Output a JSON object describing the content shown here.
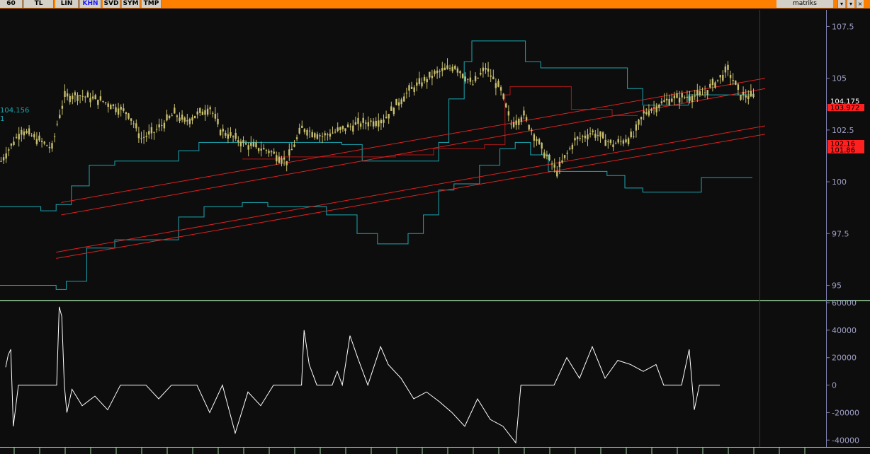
{
  "toolbar": {
    "buttons": [
      "60",
      "TL",
      "LIN",
      "KHN",
      "SVD",
      "SYM",
      "TMP"
    ],
    "active": "KHN",
    "brand": "matriks",
    "window_buttons": [
      "▾",
      "▾",
      "×"
    ]
  },
  "colors": {
    "background": "#0d0d0d",
    "candle": "#c8bf6e",
    "envelope": "#1aa7b0",
    "channel": "#e02020",
    "midline": "#b01818",
    "oscillator": "#ffffff",
    "axis_text": "#a0a0c8",
    "price_badge": "#ff2020"
  },
  "chart_data": [
    {
      "type": "line",
      "panel": "price",
      "subtype": "candlestick-with-channels",
      "ylim": [
        94.3,
        108.3
      ],
      "yticks": [
        "107.5",
        "105",
        "102.5",
        "100",
        "97.5",
        "95"
      ],
      "left_labels": [
        "104.156",
        "1"
      ],
      "price_badges": [
        "104.175",
        "103.972",
        "102.16",
        "101.86"
      ],
      "bar_count": 300,
      "close_path": [
        [
          0,
          101
        ],
        [
          8,
          102.5
        ],
        [
          15,
          102
        ],
        [
          20,
          101.6
        ],
        [
          22,
          102.8
        ],
        [
          25,
          104.1
        ],
        [
          30,
          104.2
        ],
        [
          40,
          103.9
        ],
        [
          50,
          103.3
        ],
        [
          55,
          102.1
        ],
        [
          60,
          102.4
        ],
        [
          68,
          103.3
        ],
        [
          72,
          102.9
        ],
        [
          82,
          103.6
        ],
        [
          86,
          102.5
        ],
        [
          96,
          101.8
        ],
        [
          105,
          101.5
        ],
        [
          112,
          101
        ],
        [
          118,
          102.6
        ],
        [
          126,
          102.2
        ],
        [
          140,
          102.8
        ],
        [
          150,
          103
        ],
        [
          160,
          104.4
        ],
        [
          170,
          105.2
        ],
        [
          178,
          105.6
        ],
        [
          185,
          104.7
        ],
        [
          190,
          105.5
        ],
        [
          196,
          104.4
        ],
        [
          200,
          102.8
        ],
        [
          205,
          103.2
        ],
        [
          212,
          101.6
        ],
        [
          218,
          100.5
        ],
        [
          225,
          102
        ],
        [
          232,
          102.4
        ],
        [
          240,
          101.8
        ],
        [
          248,
          102.2
        ],
        [
          252,
          103.3
        ],
        [
          262,
          104
        ],
        [
          275,
          104.2
        ],
        [
          285,
          105.4
        ],
        [
          290,
          104.2
        ],
        [
          295,
          104.1
        ]
      ],
      "envelope_upper": [
        [
          0,
          98.8
        ],
        [
          16,
          98.6
        ],
        [
          22,
          98.9
        ],
        [
          28,
          99.8
        ],
        [
          35,
          100.8
        ],
        [
          45,
          101
        ],
        [
          62,
          101
        ],
        [
          70,
          101.5
        ],
        [
          78,
          101.9
        ],
        [
          95,
          101.9
        ],
        [
          108,
          101.9
        ],
        [
          120,
          101.9
        ],
        [
          134,
          101.8
        ],
        [
          142,
          101
        ],
        [
          152,
          101
        ],
        [
          165,
          101
        ],
        [
          172,
          101.9
        ],
        [
          176,
          104
        ],
        [
          182,
          105.8
        ],
        [
          185,
          106.8
        ],
        [
          190,
          106.8
        ],
        [
          200,
          106.8
        ],
        [
          206,
          105.8
        ],
        [
          212,
          105.5
        ],
        [
          230,
          105.5
        ],
        [
          240,
          105.5
        ],
        [
          246,
          104.5
        ],
        [
          252,
          103.7
        ],
        [
          262,
          103.7
        ],
        [
          270,
          104.2
        ],
        [
          285,
          104.2
        ],
        [
          295,
          104.2
        ]
      ],
      "envelope_lower": [
        [
          0,
          95
        ],
        [
          18,
          95
        ],
        [
          22,
          94.8
        ],
        [
          26,
          95.2
        ],
        [
          34,
          96.8
        ],
        [
          45,
          97.2
        ],
        [
          60,
          97.2
        ],
        [
          70,
          98.3
        ],
        [
          80,
          98.8
        ],
        [
          95,
          99
        ],
        [
          105,
          98.8
        ],
        [
          115,
          98.8
        ],
        [
          128,
          98.4
        ],
        [
          140,
          97.5
        ],
        [
          148,
          97
        ],
        [
          160,
          97.5
        ],
        [
          166,
          98.4
        ],
        [
          172,
          99.6
        ],
        [
          178,
          99.9
        ],
        [
          188,
          100.8
        ],
        [
          196,
          101.6
        ],
        [
          202,
          101.9
        ],
        [
          208,
          101.3
        ],
        [
          215,
          100.5
        ],
        [
          230,
          100.5
        ],
        [
          238,
          100.3
        ],
        [
          245,
          99.7
        ],
        [
          252,
          99.5
        ],
        [
          265,
          99.5
        ],
        [
          275,
          100.2
        ],
        [
          285,
          100.2
        ],
        [
          295,
          100.2
        ]
      ],
      "midline": [
        [
          95,
          101.1
        ],
        [
          100,
          101.1
        ],
        [
          105,
          101.1
        ],
        [
          110,
          101.2
        ],
        [
          115,
          101.2
        ],
        [
          120,
          101.2
        ],
        [
          126,
          101.2
        ],
        [
          130,
          101.2
        ],
        [
          135,
          101.2
        ],
        [
          140,
          101.2
        ],
        [
          145,
          101.2
        ],
        [
          150,
          101.2
        ],
        [
          155,
          101.3
        ],
        [
          160,
          101.3
        ],
        [
          165,
          101.3
        ],
        [
          170,
          101.6
        ],
        [
          175,
          101.6
        ],
        [
          180,
          101.6
        ],
        [
          185,
          101.6
        ],
        [
          190,
          101.8
        ],
        [
          195,
          101.8
        ],
        [
          198,
          104.2
        ],
        [
          200,
          104.6
        ],
        [
          203,
          104.6
        ],
        [
          206,
          104.6
        ],
        [
          212,
          104.6
        ],
        [
          222,
          104.6
        ],
        [
          224,
          103.5
        ],
        [
          230,
          103.5
        ],
        [
          240,
          103.2
        ],
        [
          246,
          103.2
        ],
        [
          250,
          103.2
        ]
      ],
      "channel_lines": [
        [
          [
            24,
            99
          ],
          [
            300,
            105
          ]
        ],
        [
          [
            24,
            98.4
          ],
          [
            300,
            104.5
          ]
        ],
        [
          [
            22,
            96.6
          ],
          [
            300,
            102.7
          ]
        ],
        [
          [
            22,
            96.3
          ],
          [
            300,
            102.3
          ]
        ]
      ]
    },
    {
      "type": "line",
      "panel": "oscillator",
      "ylim": [
        -45000,
        60000
      ],
      "yticks": [
        "60000",
        "40000",
        "20000",
        "0",
        "-20000",
        "-40000"
      ],
      "values": [
        [
          0,
          13000
        ],
        [
          1,
          22000
        ],
        [
          2,
          26000
        ],
        [
          3,
          -30000
        ],
        [
          4,
          -15000
        ],
        [
          5,
          0
        ],
        [
          20,
          0
        ],
        [
          21,
          57000
        ],
        [
          22,
          50000
        ],
        [
          23,
          0
        ],
        [
          24,
          -20000
        ],
        [
          26,
          -3000
        ],
        [
          30,
          -15000
        ],
        [
          35,
          -8000
        ],
        [
          40,
          -18000
        ],
        [
          45,
          0
        ],
        [
          55,
          0
        ],
        [
          60,
          -10000
        ],
        [
          65,
          0
        ],
        [
          75,
          0
        ],
        [
          80,
          -20000
        ],
        [
          85,
          0
        ],
        [
          90,
          -35000
        ],
        [
          95,
          -5000
        ],
        [
          100,
          -15000
        ],
        [
          105,
          0
        ],
        [
          116,
          0
        ],
        [
          117,
          40000
        ],
        [
          119,
          15000
        ],
        [
          122,
          0
        ],
        [
          128,
          0
        ],
        [
          130,
          10000
        ],
        [
          132,
          0
        ],
        [
          135,
          36000
        ],
        [
          138,
          20000
        ],
        [
          142,
          0
        ],
        [
          147,
          28000
        ],
        [
          150,
          15000
        ],
        [
          155,
          5000
        ],
        [
          160,
          -10000
        ],
        [
          165,
          -5000
        ],
        [
          170,
          -12000
        ],
        [
          175,
          -20000
        ],
        [
          180,
          -30000
        ],
        [
          185,
          -10000
        ],
        [
          190,
          -25000
        ],
        [
          195,
          -30000
        ],
        [
          200,
          -42000
        ],
        [
          202,
          0
        ],
        [
          215,
          0
        ],
        [
          220,
          20000
        ],
        [
          225,
          5000
        ],
        [
          230,
          28000
        ],
        [
          235,
          5000
        ],
        [
          240,
          18000
        ],
        [
          245,
          15000
        ],
        [
          250,
          10000
        ],
        [
          255,
          15000
        ],
        [
          258,
          0
        ],
        [
          265,
          0
        ],
        [
          268,
          26000
        ],
        [
          270,
          -18000
        ],
        [
          272,
          0
        ],
        [
          280,
          0
        ]
      ]
    }
  ]
}
